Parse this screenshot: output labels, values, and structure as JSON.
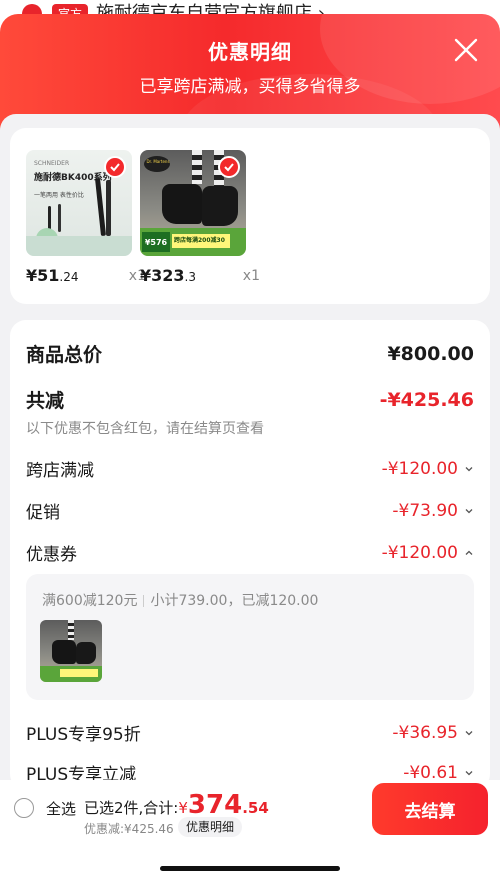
{
  "background_store": {
    "tag": "官方",
    "name": "施耐德京东自营官方旗舰店 ›"
  },
  "header": {
    "title": "优惠明细",
    "subtitle": "已享跨店满减，买得多省得多"
  },
  "products": [
    {
      "image_text": "施耐德BK400系列",
      "image_sub": "一笔两用 表性价比",
      "price_main": "¥51",
      "price_decimal": ".24",
      "qty": "x1"
    },
    {
      "image_text": "Dr. Martens",
      "image_badge": "¥576",
      "image_banner": "跨店每满200减30",
      "price_main": "¥323",
      "price_decimal": ".3",
      "qty": "x1"
    }
  ],
  "summary": {
    "total_label": "商品总价",
    "total_value": "¥800.00",
    "reduce_label": "共减",
    "reduce_value": "-¥425.46",
    "note": "以下优惠不包含红包，请在结算页查看",
    "items": [
      {
        "label": "跨店满减",
        "value": "-¥120.00",
        "chevron": "down"
      },
      {
        "label": "促销",
        "value": "-¥73.90",
        "chevron": "down"
      },
      {
        "label": "优惠券",
        "value": "-¥120.00",
        "chevron": "up"
      },
      {
        "label": "PLUS专享95折",
        "value": "-¥36.95",
        "chevron": "down"
      },
      {
        "label": "PLUS专享立减",
        "value": "-¥0.61",
        "chevron": "down"
      }
    ],
    "coupon_detail": {
      "rule": "满600减120元",
      "subtotal": "小计739.00，已减120.00"
    }
  },
  "footer": {
    "select_all": "全选",
    "selected_text": "已选2件,合计:",
    "total_prefix": "¥",
    "total_main": "374",
    "total_decimal": ".54",
    "discount_text": "优惠减:¥425.46",
    "detail_chip": "优惠明细",
    "checkout": "去结算"
  },
  "colors": {
    "accent_red": "#e8242b",
    "header_gradient_start": "#ff4a3a",
    "header_gradient_end": "#ff4b4e"
  }
}
